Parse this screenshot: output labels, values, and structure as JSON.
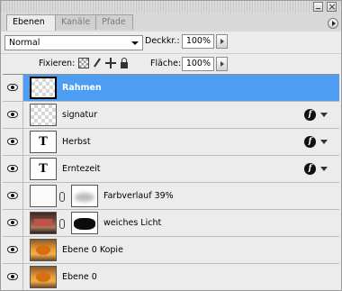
{
  "tabs": [
    {
      "label": "Ebenen",
      "active": true
    },
    {
      "label": "Kanäle",
      "active": false
    },
    {
      "label": "Pfade",
      "active": false
    }
  ],
  "blend": {
    "mode": "Normal"
  },
  "opacity": {
    "label": "Deckkr.:",
    "value": "100%"
  },
  "lock": {
    "label": "Fixieren:",
    "icons": [
      "transparency-lock-icon",
      "brush-lock-icon",
      "move-lock-icon",
      "lock-all-icon"
    ]
  },
  "fill": {
    "label": "Fläche:",
    "value": "100%"
  },
  "layers": [
    {
      "name": "Rahmen",
      "thumb": "checker",
      "selected": true,
      "fx": false
    },
    {
      "name": "signatur",
      "thumb": "checker",
      "selected": false,
      "fx": true
    },
    {
      "name": "Herbst",
      "thumb": "text",
      "thumb_glyph": "T",
      "selected": false,
      "fx": true
    },
    {
      "name": "Erntezeit",
      "thumb": "text",
      "thumb_glyph": "T",
      "selected": false,
      "fx": true
    },
    {
      "name": "Farbverlauf 39%",
      "thumb": "white",
      "mask": "soft",
      "selected": false,
      "fx": false
    },
    {
      "name": "weiches Licht",
      "thumb": "dark-photo",
      "mask": "hard",
      "selected": false,
      "fx": false
    },
    {
      "name": "Ebene 0 Kopie",
      "thumb": "photo",
      "selected": false,
      "fx": false
    },
    {
      "name": "Ebene 0",
      "thumb": "photo",
      "selected": false,
      "fx": false
    }
  ],
  "colors": {
    "selection": "#4d9ef3",
    "panel": "#ececec"
  }
}
